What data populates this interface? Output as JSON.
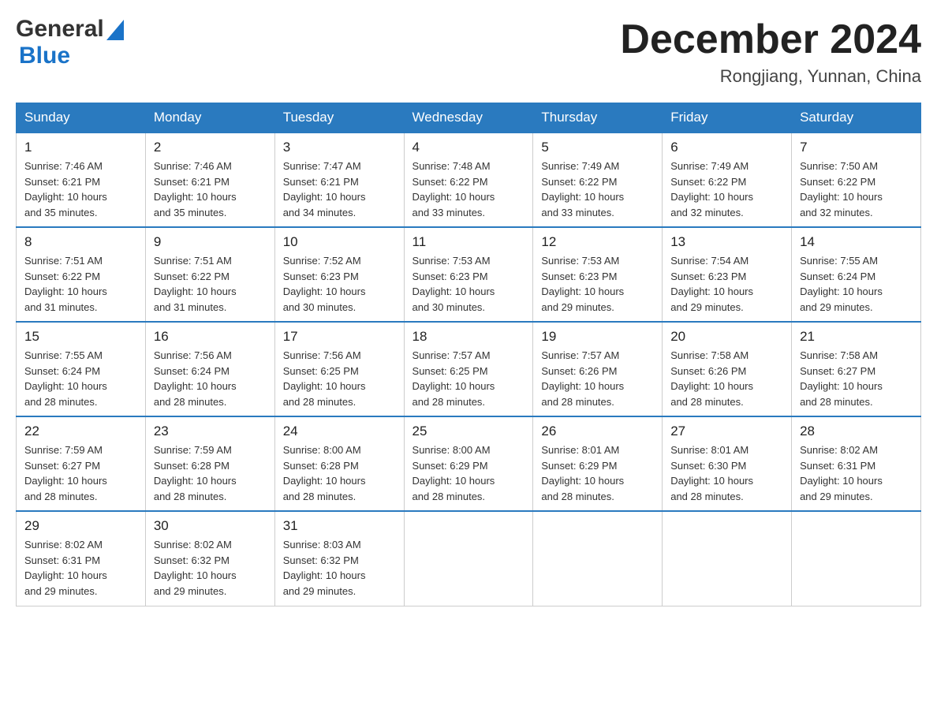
{
  "header": {
    "logo_general": "General",
    "logo_blue": "Blue",
    "month_title": "December 2024",
    "location": "Rongjiang, Yunnan, China"
  },
  "days_of_week": [
    "Sunday",
    "Monday",
    "Tuesday",
    "Wednesday",
    "Thursday",
    "Friday",
    "Saturday"
  ],
  "weeks": [
    [
      {
        "day": "1",
        "sunrise": "7:46 AM",
        "sunset": "6:21 PM",
        "daylight": "10 hours and 35 minutes."
      },
      {
        "day": "2",
        "sunrise": "7:46 AM",
        "sunset": "6:21 PM",
        "daylight": "10 hours and 35 minutes."
      },
      {
        "day": "3",
        "sunrise": "7:47 AM",
        "sunset": "6:21 PM",
        "daylight": "10 hours and 34 minutes."
      },
      {
        "day": "4",
        "sunrise": "7:48 AM",
        "sunset": "6:22 PM",
        "daylight": "10 hours and 33 minutes."
      },
      {
        "day": "5",
        "sunrise": "7:49 AM",
        "sunset": "6:22 PM",
        "daylight": "10 hours and 33 minutes."
      },
      {
        "day": "6",
        "sunrise": "7:49 AM",
        "sunset": "6:22 PM",
        "daylight": "10 hours and 32 minutes."
      },
      {
        "day": "7",
        "sunrise": "7:50 AM",
        "sunset": "6:22 PM",
        "daylight": "10 hours and 32 minutes."
      }
    ],
    [
      {
        "day": "8",
        "sunrise": "7:51 AM",
        "sunset": "6:22 PM",
        "daylight": "10 hours and 31 minutes."
      },
      {
        "day": "9",
        "sunrise": "7:51 AM",
        "sunset": "6:22 PM",
        "daylight": "10 hours and 31 minutes."
      },
      {
        "day": "10",
        "sunrise": "7:52 AM",
        "sunset": "6:23 PM",
        "daylight": "10 hours and 30 minutes."
      },
      {
        "day": "11",
        "sunrise": "7:53 AM",
        "sunset": "6:23 PM",
        "daylight": "10 hours and 30 minutes."
      },
      {
        "day": "12",
        "sunrise": "7:53 AM",
        "sunset": "6:23 PM",
        "daylight": "10 hours and 29 minutes."
      },
      {
        "day": "13",
        "sunrise": "7:54 AM",
        "sunset": "6:23 PM",
        "daylight": "10 hours and 29 minutes."
      },
      {
        "day": "14",
        "sunrise": "7:55 AM",
        "sunset": "6:24 PM",
        "daylight": "10 hours and 29 minutes."
      }
    ],
    [
      {
        "day": "15",
        "sunrise": "7:55 AM",
        "sunset": "6:24 PM",
        "daylight": "10 hours and 28 minutes."
      },
      {
        "day": "16",
        "sunrise": "7:56 AM",
        "sunset": "6:24 PM",
        "daylight": "10 hours and 28 minutes."
      },
      {
        "day": "17",
        "sunrise": "7:56 AM",
        "sunset": "6:25 PM",
        "daylight": "10 hours and 28 minutes."
      },
      {
        "day": "18",
        "sunrise": "7:57 AM",
        "sunset": "6:25 PM",
        "daylight": "10 hours and 28 minutes."
      },
      {
        "day": "19",
        "sunrise": "7:57 AM",
        "sunset": "6:26 PM",
        "daylight": "10 hours and 28 minutes."
      },
      {
        "day": "20",
        "sunrise": "7:58 AM",
        "sunset": "6:26 PM",
        "daylight": "10 hours and 28 minutes."
      },
      {
        "day": "21",
        "sunrise": "7:58 AM",
        "sunset": "6:27 PM",
        "daylight": "10 hours and 28 minutes."
      }
    ],
    [
      {
        "day": "22",
        "sunrise": "7:59 AM",
        "sunset": "6:27 PM",
        "daylight": "10 hours and 28 minutes."
      },
      {
        "day": "23",
        "sunrise": "7:59 AM",
        "sunset": "6:28 PM",
        "daylight": "10 hours and 28 minutes."
      },
      {
        "day": "24",
        "sunrise": "8:00 AM",
        "sunset": "6:28 PM",
        "daylight": "10 hours and 28 minutes."
      },
      {
        "day": "25",
        "sunrise": "8:00 AM",
        "sunset": "6:29 PM",
        "daylight": "10 hours and 28 minutes."
      },
      {
        "day": "26",
        "sunrise": "8:01 AM",
        "sunset": "6:29 PM",
        "daylight": "10 hours and 28 minutes."
      },
      {
        "day": "27",
        "sunrise": "8:01 AM",
        "sunset": "6:30 PM",
        "daylight": "10 hours and 28 minutes."
      },
      {
        "day": "28",
        "sunrise": "8:02 AM",
        "sunset": "6:31 PM",
        "daylight": "10 hours and 29 minutes."
      }
    ],
    [
      {
        "day": "29",
        "sunrise": "8:02 AM",
        "sunset": "6:31 PM",
        "daylight": "10 hours and 29 minutes."
      },
      {
        "day": "30",
        "sunrise": "8:02 AM",
        "sunset": "6:32 PM",
        "daylight": "10 hours and 29 minutes."
      },
      {
        "day": "31",
        "sunrise": "8:03 AM",
        "sunset": "6:32 PM",
        "daylight": "10 hours and 29 minutes."
      },
      null,
      null,
      null,
      null
    ]
  ],
  "labels": {
    "sunrise_prefix": "Sunrise: ",
    "sunset_prefix": "Sunset: ",
    "daylight_prefix": "Daylight: "
  }
}
